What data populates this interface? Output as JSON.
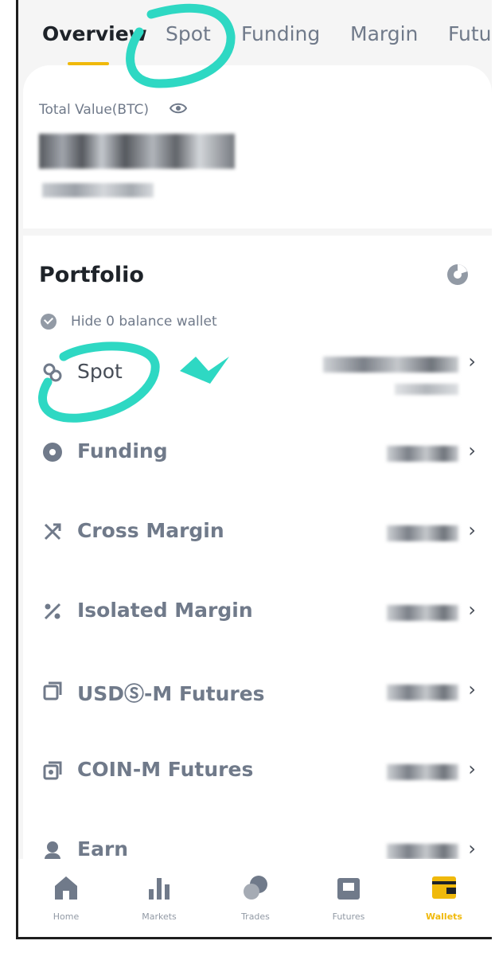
{
  "tabs": [
    "Overview",
    "Spot",
    "Funding",
    "Margin",
    "Futu"
  ],
  "active_tab": "Overview",
  "total_value_label": "Total Value(BTC)",
  "portfolio_title": "Portfolio",
  "hide_zero_label": "Hide 0 balance wallet",
  "wallets": [
    {
      "label": "Spot",
      "icon": "spot-icon"
    },
    {
      "label": "Funding",
      "icon": "funding-icon"
    },
    {
      "label": "Cross Margin",
      "icon": "cross-margin-icon"
    },
    {
      "label": "Isolated Margin",
      "icon": "isolated-margin-icon"
    },
    {
      "label": "USDⓈ-M Futures",
      "icon": "usd-m-futures-icon"
    },
    {
      "label": "COIN-M Futures",
      "icon": "coin-m-futures-icon"
    },
    {
      "label": "Earn",
      "icon": "earn-icon"
    }
  ],
  "nav": [
    {
      "label": "Home",
      "icon": "home-icon"
    },
    {
      "label": "Markets",
      "icon": "markets-icon"
    },
    {
      "label": "Trades",
      "icon": "trades-icon"
    },
    {
      "label": "Futures",
      "icon": "futures-icon"
    },
    {
      "label": "Wallets",
      "icon": "wallet-icon",
      "active": true
    }
  ],
  "colors": {
    "accent": "#f0b90b",
    "annotation": "#2ed8c3",
    "text_primary": "#1e2329",
    "text_secondary": "#707a8a"
  }
}
